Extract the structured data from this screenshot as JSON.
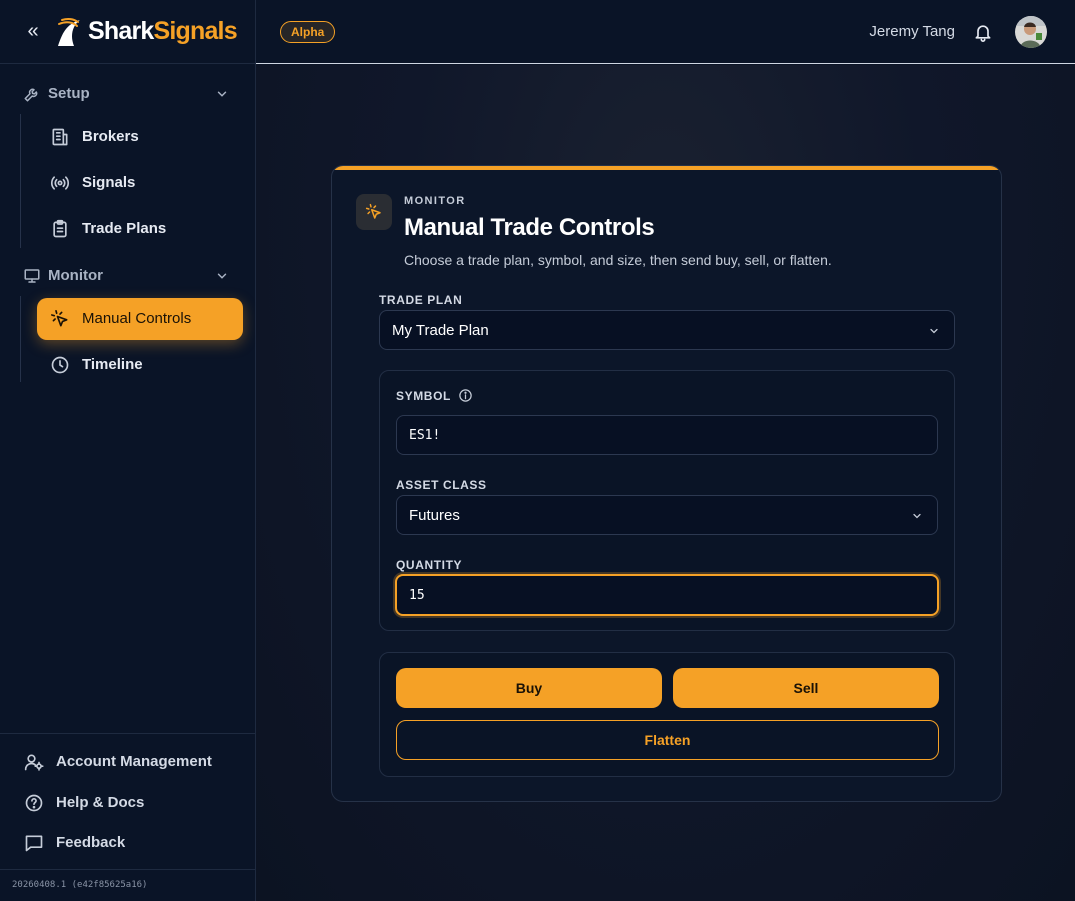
{
  "brand": {
    "name_part1": "Shark",
    "name_part2": "Signals",
    "badge": "Alpha"
  },
  "sidebar": {
    "collapse_glyph": "«",
    "groups": [
      {
        "label": "Setup",
        "icon": "wrench-icon",
        "items": [
          {
            "label": "Brokers",
            "icon": "building-icon"
          },
          {
            "label": "Signals",
            "icon": "broadcast-icon"
          },
          {
            "label": "Trade Plans",
            "icon": "clipboard-icon"
          }
        ]
      },
      {
        "label": "Monitor",
        "icon": "monitor-icon",
        "items": [
          {
            "label": "Manual Controls",
            "icon": "pointer-click-icon",
            "active": true
          },
          {
            "label": "Timeline",
            "icon": "clock-icon"
          }
        ]
      }
    ],
    "footer": [
      {
        "label": "Account Management",
        "icon": "user-gear-icon"
      },
      {
        "label": "Help & Docs",
        "icon": "help-circle-icon"
      },
      {
        "label": "Feedback",
        "icon": "message-icon"
      }
    ],
    "version": "20260408.1 (e42f85625a16)"
  },
  "header": {
    "user_name": "Jeremy Tang"
  },
  "card": {
    "eyebrow": "MONITOR",
    "title": "Manual Trade Controls",
    "subtitle": "Choose a trade plan, symbol, and size, then send buy, sell, or flatten.",
    "trade_plan": {
      "label": "TRADE PLAN",
      "value": "My Trade Plan"
    },
    "symbol": {
      "label": "SYMBOL",
      "value": "ES1!"
    },
    "asset_class": {
      "label": "ASSET CLASS",
      "value": "Futures"
    },
    "quantity": {
      "label": "QUANTITY",
      "value": "15"
    },
    "actions": {
      "buy": "Buy",
      "sell": "Sell",
      "flatten": "Flatten"
    }
  },
  "colors": {
    "accent": "#f5a126",
    "background": "#0b1426"
  }
}
